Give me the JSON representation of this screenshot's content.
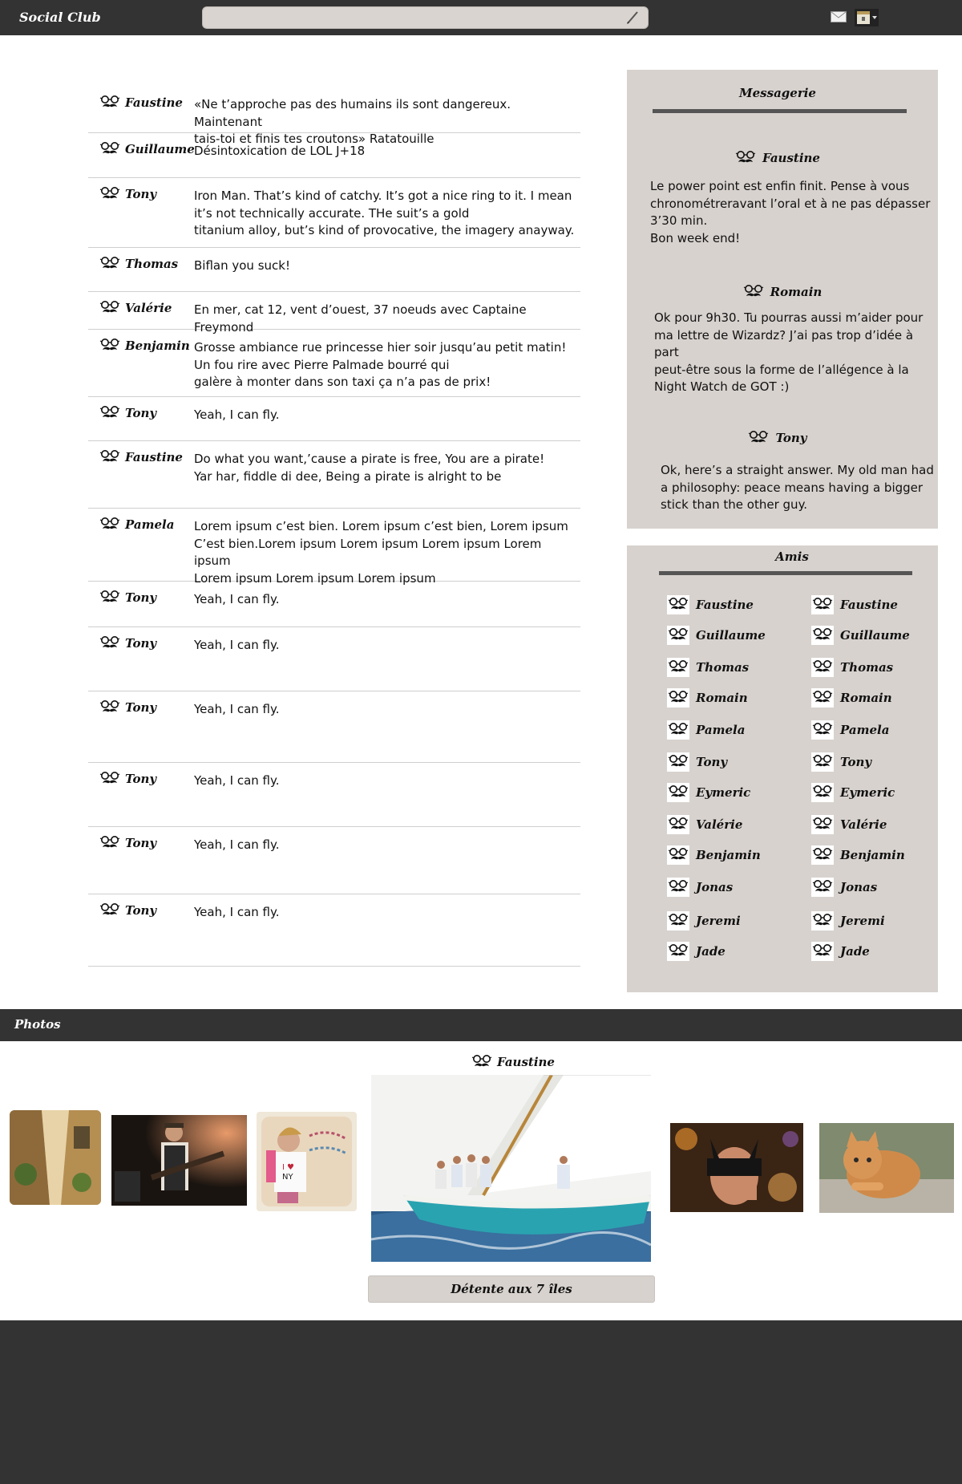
{
  "header": {
    "brand": "Social Club",
    "search_placeholder": ""
  },
  "feed": [
    {
      "name": "Faustine",
      "text": "«Ne t’approche pas des humains ils sont dangereux. Maintenant\n tais-toi et finis tes croutons» Ratatouille"
    },
    {
      "name": "Guillaume",
      "text": "Désintoxication de LOL J+18"
    },
    {
      "name": "Tony",
      "text": "Iron Man. That’s kind of catchy. It’s got a nice ring to it. I mean\n it’s not technically accurate. THe suit’s a gold\ntitanium alloy, but’s kind of provocative, the imagery anayway."
    },
    {
      "name": "Thomas",
      "text": "Biflan you suck!"
    },
    {
      "name": "Valérie",
      "text": "En mer, cat 12, vent d’ouest, 37 noeuds avec Captaine Freymond"
    },
    {
      "name": "Benjamin",
      "text": "Grosse ambiance rue princesse hier soir jusqu’au petit matin!\nUn fou rire avec Pierre Palmade bourré qui\ngalère à monter dans son taxi ça n’a pas de prix!"
    },
    {
      "name": "Tony",
      "text": "Yeah, I can fly."
    },
    {
      "name": "Faustine",
      "text": "Do what you want,’cause a pirate is free, You are a pirate!\nYar har, fiddle di dee, Being a pirate is alright to be"
    },
    {
      "name": "Pamela",
      "text": "Lorem ipsum c’est bien. Lorem ipsum c’est bien, Lorem ipsum\nC’est bien.Lorem ipsum Lorem ipsum Lorem ipsum Lorem ipsum\nLorem ipsum Lorem ipsum Lorem ipsum"
    },
    {
      "name": "Tony",
      "text": "Yeah, I can fly."
    },
    {
      "name": "Tony",
      "text": "Yeah, I can fly."
    },
    {
      "name": "Tony",
      "text": "Yeah, I can fly."
    },
    {
      "name": "Tony",
      "text": "Yeah, I can fly."
    },
    {
      "name": "Tony",
      "text": "Yeah, I can fly."
    },
    {
      "name": "Tony",
      "text": "Yeah, I can fly."
    }
  ],
  "messagerie": {
    "title": "Messagerie",
    "messages": [
      {
        "name": "Faustine",
        "text": "Le power point est enfin finit. Pense à vous\nchronométreravant l’oral et à ne pas dépasser\n3’30 min.\nBon week end!"
      },
      {
        "name": "Romain",
        "text": "Ok pour 9h30. Tu pourras aussi m’aider pour\nma lettre de Wizardz? J’ai pas trop d’idée à part\n peut-être sous la forme de l’allégence à la\nNight Watch de GOT :)"
      },
      {
        "name": "Tony",
        "text": "Ok, here’s a straight answer. My old man had\na philosophy: peace means having a bigger\nstick than the other guy."
      }
    ]
  },
  "amis": {
    "title": "Amis",
    "friends": [
      "Faustine",
      "Guillaume",
      "Thomas",
      "Romain",
      "Pamela",
      "Tony",
      "Eymeric",
      "Valérie",
      "Benjamin",
      "Jonas",
      "Jeremi",
      "Jade"
    ]
  },
  "photos": {
    "title": "Photos",
    "featured_author": "Faustine",
    "caption": "Détente aux 7 îles"
  },
  "colors": {
    "bar": "#333333",
    "panel": "#d7d2ce",
    "search": "#d9d4cf"
  }
}
